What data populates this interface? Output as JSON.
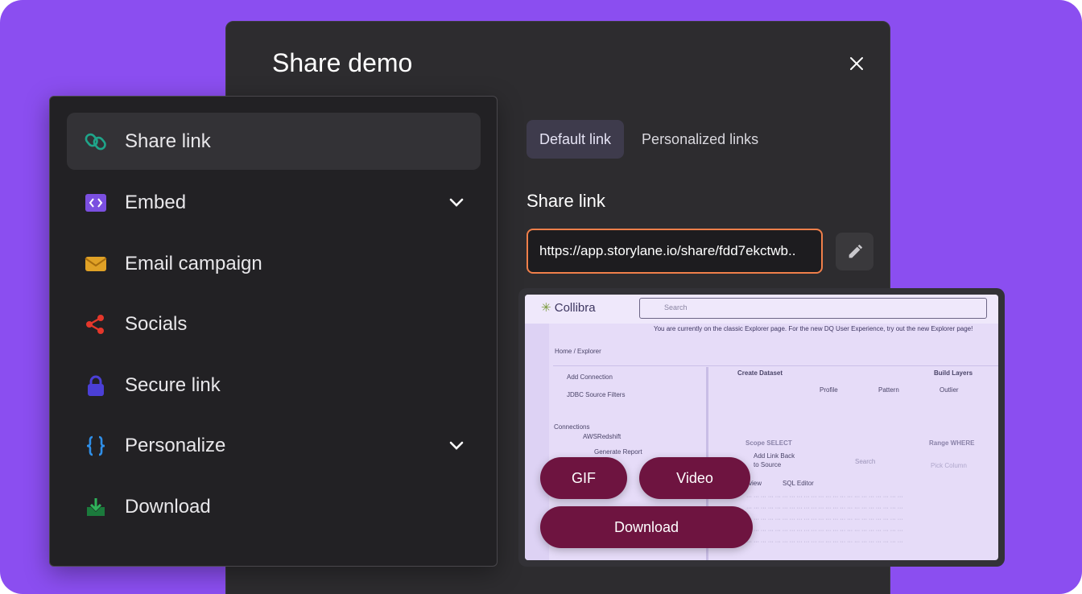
{
  "modal": {
    "title": "Share demo",
    "tabs": [
      {
        "label": "Default link",
        "active": true
      },
      {
        "label": "Personalized links",
        "active": false
      }
    ],
    "share_link_label": "Share link",
    "url_value": "https://app.storylane.io/share/fdd7ekctwb.."
  },
  "menu": {
    "items": [
      {
        "label": "Share link",
        "icon": "link-icon",
        "active": true,
        "has_chevron": false
      },
      {
        "label": "Embed",
        "icon": "embed-code-icon",
        "active": false,
        "has_chevron": true
      },
      {
        "label": "Email campaign",
        "icon": "envelope-icon",
        "active": false,
        "has_chevron": false
      },
      {
        "label": "Socials",
        "icon": "share-nodes-icon",
        "active": false,
        "has_chevron": false
      },
      {
        "label": "Secure link",
        "icon": "lock-icon",
        "active": false,
        "has_chevron": false
      },
      {
        "label": "Personalize",
        "icon": "curly-braces-icon",
        "active": false,
        "has_chevron": true
      },
      {
        "label": "Download",
        "icon": "download-icon",
        "active": false,
        "has_chevron": false
      }
    ]
  },
  "preview": {
    "app_name": "Collibra",
    "search_placeholder": "Search",
    "banner": "You are currently on the classic Explorer page. For the new DQ User Experience, try out the new Explorer page!",
    "breadcrumb": "Home / Explorer",
    "add_connection": "Add Connection",
    "source_filter": "JDBC Source Filters",
    "connections": "Connections",
    "aws": "AWSRedshift",
    "generate_report": "Generate Report",
    "create_dataset": "Create Dataset",
    "build_layers": "Build Layers",
    "profile": "Profile",
    "pattern": "Pattern",
    "outlier": "Outlier",
    "scope": "Scope SELECT",
    "add_link_back": "Add Link Back",
    "to_source": "to Source",
    "search2": "Search",
    "range": "Range WHERE",
    "pick_column": "Pick Column",
    "view": "view",
    "sql_editor": "SQL Editor",
    "buttons": {
      "gif": "GIF",
      "video": "Video",
      "download": "Download"
    }
  },
  "colors": {
    "background": "#8b4ef0",
    "modal": "#2d2c2f",
    "menu": "#222124",
    "url_border": "#f07f4a",
    "pill": "#6e1440"
  }
}
